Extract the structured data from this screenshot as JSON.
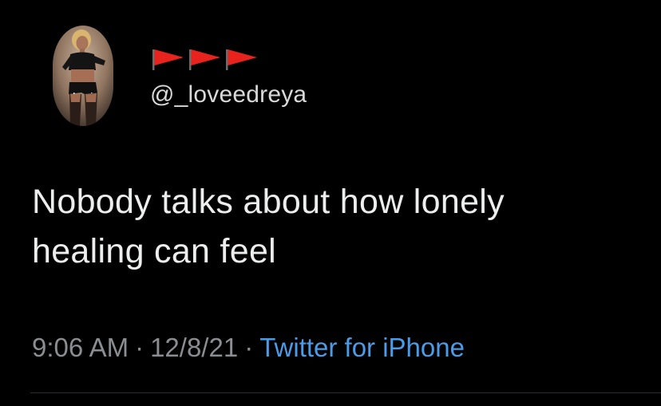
{
  "tweet": {
    "display_name_flags": [
      "red-flag-emoji",
      "red-flag-emoji",
      "red-flag-emoji"
    ],
    "handle": "@_loveedreya",
    "text_line1": "Nobody talks about how lonely",
    "text_line2": "healing can feel",
    "time": "9:06 AM",
    "separator": "·",
    "date": "12/8/21",
    "source": "Twitter for iPhone"
  },
  "colors": {
    "background": "#000000",
    "text": "#eceded",
    "muted": "#8a8d91",
    "link": "#4a9be8",
    "flag": "#e8231d"
  }
}
